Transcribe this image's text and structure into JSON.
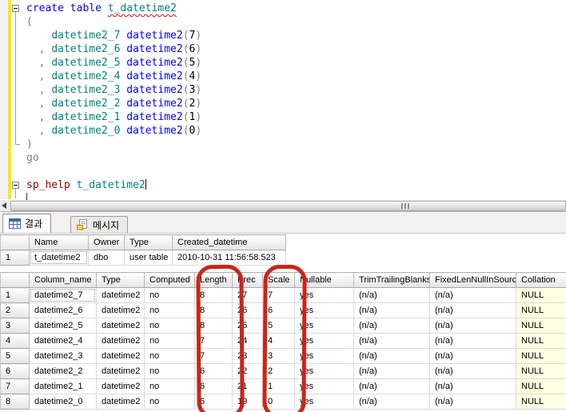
{
  "editor": {
    "lines": [
      {
        "collapse": true,
        "tokens": [
          {
            "t": "create table",
            "c": "kw"
          },
          {
            "t": " "
          },
          {
            "t": "t_datetime2",
            "c": "id err"
          }
        ]
      },
      {
        "tokens": [
          {
            "t": "(",
            "c": "op"
          }
        ]
      },
      {
        "tokens": [
          {
            "t": "    "
          },
          {
            "t": "datetime2_7",
            "c": "id"
          },
          {
            "t": " "
          },
          {
            "t": "datetime2",
            "c": "kw"
          },
          {
            "t": "(",
            "c": "op"
          },
          {
            "t": "7"
          },
          {
            "t": ")",
            "c": "op"
          }
        ]
      },
      {
        "tokens": [
          {
            "t": "  "
          },
          {
            "t": ",",
            "c": "op"
          },
          {
            "t": " "
          },
          {
            "t": "datetime2_6",
            "c": "id"
          },
          {
            "t": " "
          },
          {
            "t": "datetime2",
            "c": "kw"
          },
          {
            "t": "(",
            "c": "op"
          },
          {
            "t": "6"
          },
          {
            "t": ")",
            "c": "op"
          }
        ]
      },
      {
        "tokens": [
          {
            "t": "  "
          },
          {
            "t": ",",
            "c": "op"
          },
          {
            "t": " "
          },
          {
            "t": "datetime2_5",
            "c": "id"
          },
          {
            "t": " "
          },
          {
            "t": "datetime2",
            "c": "kw"
          },
          {
            "t": "(",
            "c": "op"
          },
          {
            "t": "5"
          },
          {
            "t": ")",
            "c": "op"
          }
        ]
      },
      {
        "tokens": [
          {
            "t": "  "
          },
          {
            "t": ",",
            "c": "op"
          },
          {
            "t": " "
          },
          {
            "t": "datetime2_4",
            "c": "id"
          },
          {
            "t": " "
          },
          {
            "t": "datetime2",
            "c": "kw"
          },
          {
            "t": "(",
            "c": "op"
          },
          {
            "t": "4"
          },
          {
            "t": ")",
            "c": "op"
          }
        ]
      },
      {
        "tokens": [
          {
            "t": "  "
          },
          {
            "t": ",",
            "c": "op"
          },
          {
            "t": " "
          },
          {
            "t": "datetime2_3",
            "c": "id"
          },
          {
            "t": " "
          },
          {
            "t": "datetime2",
            "c": "kw"
          },
          {
            "t": "(",
            "c": "op"
          },
          {
            "t": "3"
          },
          {
            "t": ")",
            "c": "op"
          }
        ]
      },
      {
        "tokens": [
          {
            "t": "  "
          },
          {
            "t": ",",
            "c": "op"
          },
          {
            "t": " "
          },
          {
            "t": "datetime2_2",
            "c": "id"
          },
          {
            "t": " "
          },
          {
            "t": "datetime2",
            "c": "kw"
          },
          {
            "t": "(",
            "c": "op"
          },
          {
            "t": "2"
          },
          {
            "t": ")",
            "c": "op"
          }
        ]
      },
      {
        "tokens": [
          {
            "t": "  "
          },
          {
            "t": ",",
            "c": "op"
          },
          {
            "t": " "
          },
          {
            "t": "datetime2_1",
            "c": "id"
          },
          {
            "t": " "
          },
          {
            "t": "datetime2",
            "c": "kw"
          },
          {
            "t": "(",
            "c": "op"
          },
          {
            "t": "1"
          },
          {
            "t": ")",
            "c": "op"
          }
        ]
      },
      {
        "tokens": [
          {
            "t": "  "
          },
          {
            "t": ",",
            "c": "op"
          },
          {
            "t": " "
          },
          {
            "t": "datetime2_0",
            "c": "id"
          },
          {
            "t": " "
          },
          {
            "t": "datetime2",
            "c": "kw"
          },
          {
            "t": "(",
            "c": "op"
          },
          {
            "t": "0"
          },
          {
            "t": ")",
            "c": "op"
          }
        ]
      },
      {
        "tokens": [
          {
            "t": ")",
            "c": "op"
          }
        ]
      },
      {
        "tokens": [
          {
            "t": "go",
            "c": "op"
          }
        ]
      },
      {
        "tokens": []
      },
      {
        "collapse": true,
        "cursor": true,
        "tokens": [
          {
            "t": "sp_help",
            "c": "proc"
          },
          {
            "t": " "
          },
          {
            "t": "t_datetime2",
            "c": "id"
          }
        ]
      }
    ]
  },
  "tabs": {
    "results": {
      "label": "결과"
    },
    "messages": {
      "label": "메시지"
    }
  },
  "grid1": {
    "columns": [
      "",
      "Name",
      "Owner",
      "Type",
      "Created_datetime"
    ],
    "widths": [
      36,
      74,
      45,
      60,
      142
    ],
    "focus": [
      0,
      1
    ],
    "rows": [
      [
        "1",
        "t_datetime2",
        "dbo",
        "user table",
        "2010-10-31 11:56:58.523"
      ]
    ]
  },
  "grid2": {
    "columns": [
      "",
      "Column_name",
      "Type",
      "Computed",
      "Length",
      "Prec",
      "Scale",
      "Nullable",
      "TrimTrailingBlanks",
      "FixedLenNullInSource",
      "Collation"
    ],
    "widths": [
      36,
      84,
      60,
      63,
      47,
      38,
      40,
      74,
      95,
      108,
      66
    ],
    "focus": [
      0,
      1
    ],
    "rows": [
      [
        "1",
        "datetime2_7",
        "datetime2",
        "no",
        "8",
        "27",
        "7",
        "yes",
        "(n/a)",
        "(n/a)",
        "NULL"
      ],
      [
        "2",
        "datetime2_6",
        "datetime2",
        "no",
        "8",
        "26",
        "6",
        "yes",
        "(n/a)",
        "(n/a)",
        "NULL"
      ],
      [
        "3",
        "datetime2_5",
        "datetime2",
        "no",
        "8",
        "25",
        "5",
        "yes",
        "(n/a)",
        "(n/a)",
        "NULL"
      ],
      [
        "4",
        "datetime2_4",
        "datetime2",
        "no",
        "7",
        "24",
        "4",
        "yes",
        "(n/a)",
        "(n/a)",
        "NULL"
      ],
      [
        "5",
        "datetime2_3",
        "datetime2",
        "no",
        "7",
        "23",
        "3",
        "yes",
        "(n/a)",
        "(n/a)",
        "NULL"
      ],
      [
        "6",
        "datetime2_2",
        "datetime2",
        "no",
        "6",
        "22",
        "2",
        "yes",
        "(n/a)",
        "(n/a)",
        "NULL"
      ],
      [
        "7",
        "datetime2_1",
        "datetime2",
        "no",
        "6",
        "21",
        "1",
        "yes",
        "(n/a)",
        "(n/a)",
        "NULL"
      ],
      [
        "8",
        "datetime2_0",
        "datetime2",
        "no",
        "6",
        "19",
        "0",
        "yes",
        "(n/a)",
        "(n/a)",
        "NULL"
      ]
    ]
  },
  "annotations": [
    {
      "target": "Length column"
    },
    {
      "target": "Scale column"
    }
  ],
  "colors": {
    "keyword": "#0000ff",
    "identifier": "#008080",
    "operator_gray": "#808080",
    "system_proc": "#8b0000",
    "squiggle_red": "#e00000",
    "change_bar_yellow": "#f5e813",
    "annotation_red": "#ce2318",
    "null_cell_bg": "#ffffe1"
  }
}
